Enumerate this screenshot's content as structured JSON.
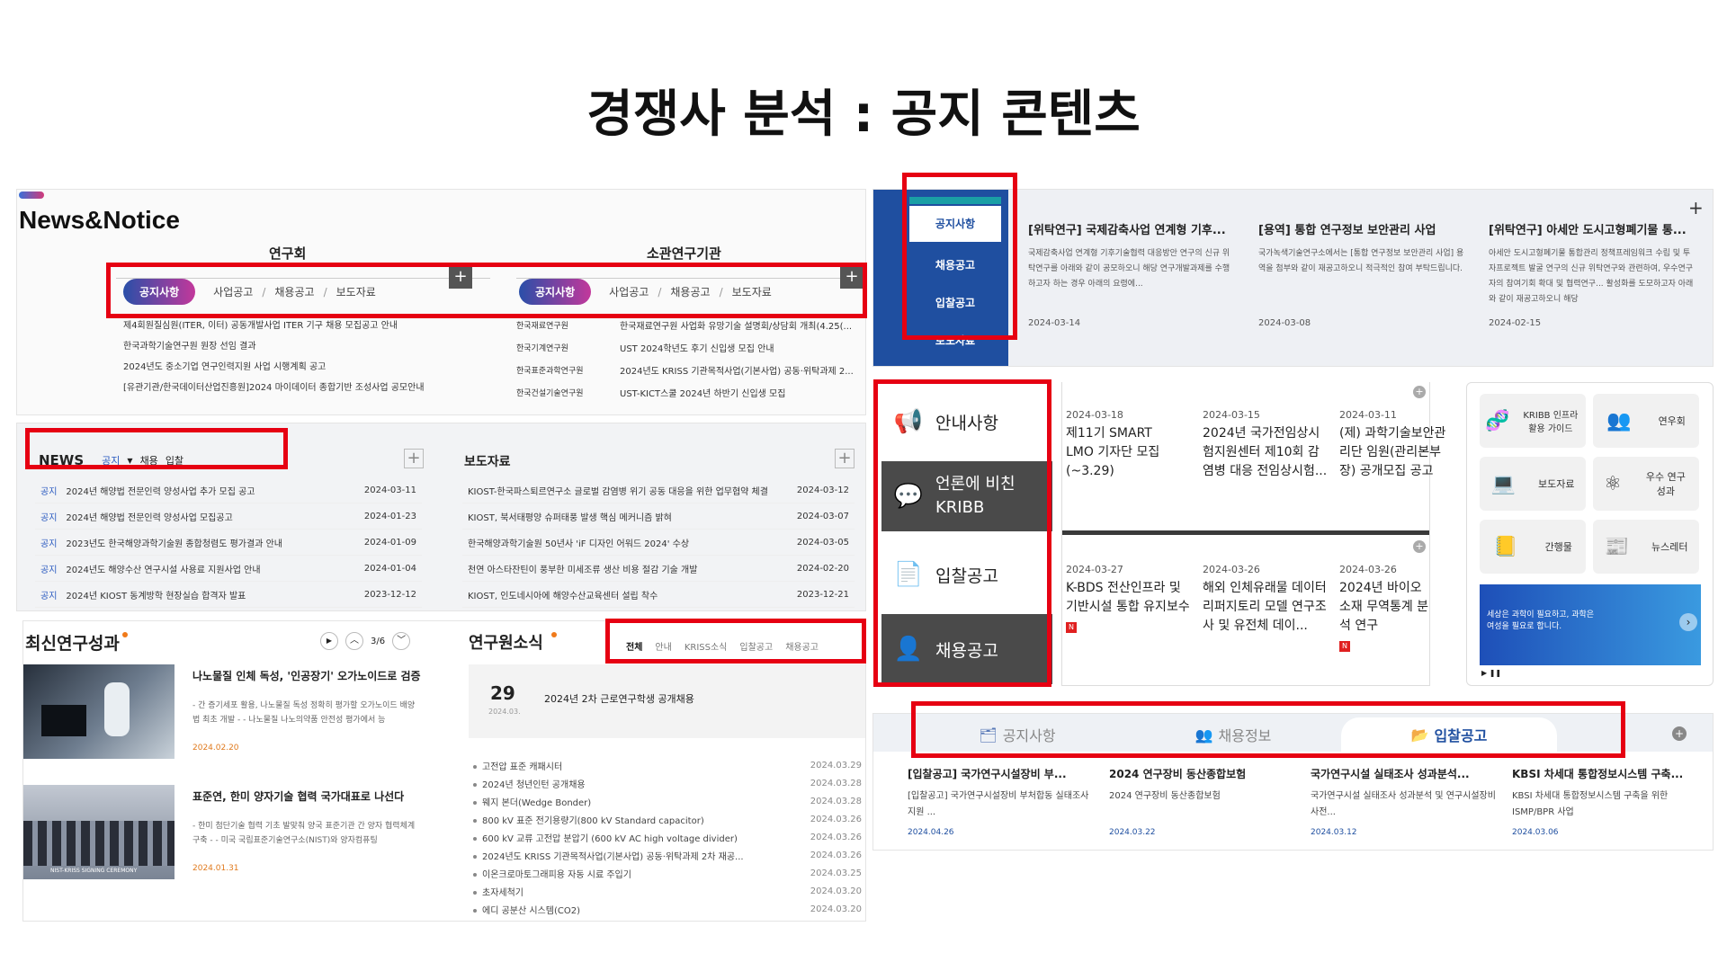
{
  "title": "경쟁사 분석 : 공지 콘텐츠",
  "p1": {
    "heading": "News&Notice",
    "group_left": "연구회",
    "group_right": "소관연구기관",
    "tabs_left": [
      "공지사항",
      "사업공고",
      "채용공고",
      "보도자료"
    ],
    "tabs_right": [
      "공지사항",
      "사업공고",
      "채용공고",
      "보도자료"
    ],
    "list_left": [
      "제4회원질심원(ITER, 이터) 공동개발사업 ITER 기구 채용 모집공고 안내",
      "한국과학기술연구원 원장 선임 결과",
      "2024년도 중소기업 연구인력지원 사업 시행계획 공고",
      "[유관기관/한국데이터산업진흥원]2024 마이데이터 종합기반 조성사업 공모안내"
    ],
    "list_right": [
      {
        "org": "한국재료연구원",
        "text": "한국재료연구원 사업화 유망기술 설명회/상담회 개최(4.25(..."
      },
      {
        "org": "한국기계연구원",
        "text": "UST 2024학년도 후기 신입생 모집 안내"
      },
      {
        "org": "한국표준과학연구원",
        "text": "2024년도 KRISS 기관목적사업(기본사업) 공동·위탁과제 2..."
      },
      {
        "org": "한국건설기술연구원",
        "text": "UST-KICT스쿨 2024년 하반기 신입생 모집"
      }
    ]
  },
  "p2": {
    "news_title": "NEWS",
    "news_filters": [
      "공지",
      "채용",
      "입찰"
    ],
    "news_rows": [
      {
        "tag": "공지",
        "text": "2024년 해양법 전문인력 양성사업 추가 모집 공고",
        "date": "2024-03-11"
      },
      {
        "tag": "공지",
        "text": "2024년 해양법 전문인력 양성사업 모집공고",
        "date": "2024-01-23"
      },
      {
        "tag": "공지",
        "text": "2023년도 한국해양과학기술원 종합청렴도 평가결과 안내",
        "date": "2024-01-09"
      },
      {
        "tag": "공지",
        "text": "2024년도 해양수산 연구시설 사용료 지원사업 안내",
        "date": "2024-01-04"
      },
      {
        "tag": "공지",
        "text": "2024년 KIOST 동계방학 현장실습 합격자 발표",
        "date": "2023-12-12"
      }
    ],
    "press_title": "보도자료",
    "press_rows": [
      {
        "text": "KIOST-한국파스퇴르연구소 글로벌 감염병 위기 공동 대응을 위한 업무협약 체결",
        "date": "2024-03-12"
      },
      {
        "text": "KIOST, 북서태평양 슈퍼태풍 발생 핵심 메커니즘 밝혀",
        "date": "2024-03-07"
      },
      {
        "text": "한국해양과학기술원 50년사 'iF 디자인 어워드 2024' 수상",
        "date": "2024-03-05"
      },
      {
        "text": "천연 아스타잔틴이 풍부한 미세조류 생산 비용 절감 기술 개발",
        "date": "2024-02-20"
      },
      {
        "text": "KIOST, 인도네시아에 해양수산교육센터 설립 착수",
        "date": "2023-12-21"
      }
    ]
  },
  "p3": {
    "research_title": "최신연구성과",
    "pager": "3/6",
    "items": [
      {
        "title": "나노물질 인체 독성, '인공장기' 오가노이드로 검증",
        "desc": "- 간 증기세포 활용, 나노물질 독성 정확히 평가할 오가노이드 배양법 최초 개발 - - 나노물질 나노의약품 안전성 평가에서 능",
        "date": "2024.02.20"
      },
      {
        "title": "표준연, 한미 양자기술 협력 국가대표로 나선다",
        "desc": "- 한미 첨단기술 협력 기초 발맞춰 양국 표준기관 간 양자 협력체계 구축 - - 미국 국립표준기술연구소(NIST)와 양자컴퓨팅",
        "date": "2024.01.31"
      }
    ],
    "thumb_caption": "NIST-KRISS SIGNING CEREMONY",
    "news_title": "연구원소식",
    "filters": [
      "전체",
      "안내",
      "KRISS소식",
      "입찰공고",
      "채용공고"
    ],
    "feature": {
      "day": "29",
      "ym": "2024.03.",
      "text": "2024년 2차 근로연구학생 공개채용"
    },
    "rows": [
      {
        "text": "고전압 표준 캐패시터",
        "date": "2024.03.29"
      },
      {
        "text": "2024년 청년인턴 공개채용",
        "date": "2024.03.28"
      },
      {
        "text": "웨지 본더(Wedge Bonder)",
        "date": "2024.03.28"
      },
      {
        "text": "800 kV 표준 전기용량기(800 kV Standard capacitor)",
        "date": "2024.03.26"
      },
      {
        "text": "600 kV 교류 고전압 분압기 (600 kV AC high voltage divider)",
        "date": "2024.03.26"
      },
      {
        "text": "2024년도 KRISS 기관목적사업(기본사업) 공동·위탁과제 2차 재공...",
        "date": "2024.03.26"
      },
      {
        "text": "이온크로마토그래피용 자동 시료 주입기",
        "date": "2024.03.25"
      },
      {
        "text": "초자세척기",
        "date": "2024.03.20"
      },
      {
        "text": "에디 공분산 시스템(CO2)",
        "date": "2024.03.20"
      }
    ]
  },
  "p4": {
    "tabs": [
      "공지사항",
      "채용공고",
      "입찰공고",
      "보도자료"
    ],
    "cards": [
      {
        "title": "[위탁연구] 국제감축사업 연계형 기후...",
        "body": "국제감축사업 연계형 기후기술협력 대응방안 연구의 신규 위탁연구를 아래와 같이 공모하오니 해당 연구개발과제를 수행하고자 하는 경우 아래의 요령에...",
        "date": "2024-03-14"
      },
      {
        "title": "[용역] 통합 연구정보 보안관리 사업",
        "body": "국가녹색기술연구소에서는 [통합 연구정보 보안관리 사업] 용역을 첨부와 같이 재공고하오니 적극적인 참여 부탁드립니다.",
        "date": "2024-03-08"
      },
      {
        "title": "[위탁연구] 아세안 도시고형폐기물 통...",
        "body": "아세안 도시고형폐기물 통합관리 정책프레임워크 수립 및 투자프로젝트 발굴 연구의 신규 위탁연구와 관련하여, 우수연구자의 참여기회 확대 및 협력연구... 활성화를 도모하고자 아래와 같이 재공고하오니 해당",
        "date": "2024-02-15"
      }
    ],
    "plus": "+"
  },
  "p5": {
    "side": [
      "안내사항",
      "언론에 비친 KRIBB",
      "입찰공고",
      "채용공고"
    ],
    "news": [
      {
        "date": "2024-03-18",
        "title": "제11기 SMART LMO 기자단 모집 (~3.29)",
        "new": false
      },
      {
        "date": "2024-03-15",
        "title": "2024년 국가전임상시험지원센터 제10회 감염병 대응 전임상시험...",
        "new": false
      },
      {
        "date": "2024-03-11",
        "title": "(제) 과학기술보안관리단 임원(관리본부장) 공개모집 공고",
        "new": false
      },
      {
        "date": "2024-03-27",
        "title": "K-BDS 전산인프라 및 기반시설 통합 유지보수",
        "new": true
      },
      {
        "date": "2024-03-26",
        "title": "해외 인체유래물 데이터 리퍼지토리 모델 연구조사 및 유전체 데이...",
        "new": false
      },
      {
        "date": "2024-03-26",
        "title": "2024년 바이오소재 무역통계 분석 연구",
        "new": true
      }
    ],
    "quick": [
      {
        "label": "KRIBB 인프라 활용 가이드",
        "icon": "dna-icon"
      },
      {
        "label": "연우회",
        "icon": "people-icon"
      },
      {
        "label": "보도자료",
        "icon": "laptop-icon"
      },
      {
        "label": "우수 연구성과",
        "icon": "molecule-icon"
      },
      {
        "label": "간행물",
        "icon": "book-icon"
      },
      {
        "label": "뉴스레터",
        "icon": "newsletter-icon"
      }
    ],
    "banner": "세상은 과학이 필요하고, 과학은 여성을 필요로 합니다."
  },
  "p6": {
    "tabs": [
      "공지사항",
      "채용정보",
      "입찰공고"
    ],
    "cards": [
      {
        "title": "[입찰공고] 국가연구시설장비 부...",
        "body": "[입찰공고] 국가연구시설장비 부처합동 실태조사 지원 ...",
        "date": "2024.04.26"
      },
      {
        "title": "2024 연구장비 동산종합보험",
        "body": "2024 연구장비 동산종합보험",
        "date": "2024.03.22"
      },
      {
        "title": "국가연구시설 실태조사 성과분석...",
        "body": "국가연구시설 실태조사 성과분석 및 연구시설장비 사전...",
        "date": "2024.03.12"
      },
      {
        "title": "KBSI 차세대 통합정보시스템 구축...",
        "body": "KBSI 차세대 통합정보시스템 구축을 위한 ISMP/BPR 사업",
        "date": "2024.03.06"
      }
    ]
  },
  "colors": {
    "highlight": "#e60012",
    "brand_blue": "#1f4fa0",
    "teal": "#1a9fa5"
  }
}
